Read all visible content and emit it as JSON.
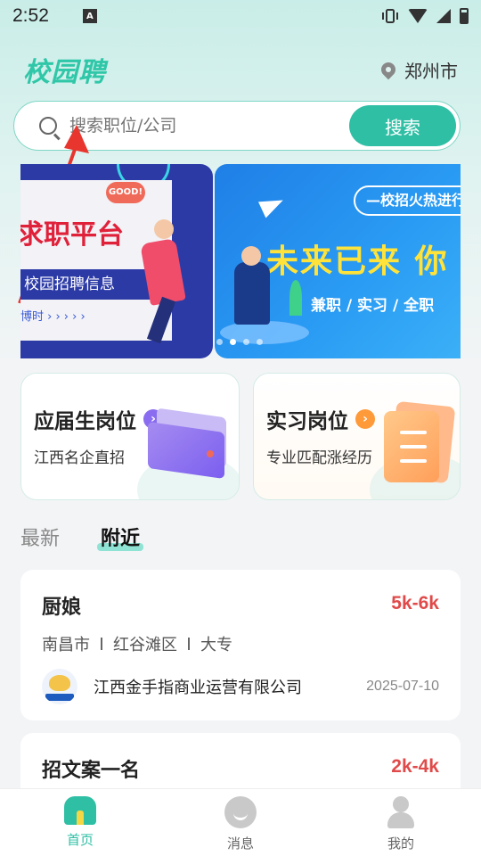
{
  "status_bar": {
    "time": "2:52",
    "app_badge": "A"
  },
  "header": {
    "logo": "校园聘",
    "city": "郑州市"
  },
  "search": {
    "placeholder": "搜索职位/公司",
    "button": "搜索"
  },
  "banner": {
    "left": {
      "title": "求职平台",
      "subtitle": "校园招聘信息",
      "time": "博时 › › › › ›",
      "badge": "GOOD!"
    },
    "right": {
      "tag": "—校招火热进行",
      "title": "未来已来 你",
      "subtitle": "兼职 / 实习 / 全职"
    },
    "page_count": 4,
    "active_page": 1
  },
  "categories": [
    {
      "title": "应届生岗位",
      "subtitle": "江西名企直招",
      "chevron": "›",
      "color": "#8a6cf0"
    },
    {
      "title": "实习岗位",
      "subtitle": "专业匹配涨经历",
      "chevron": "›",
      "color": "#ff9a3a"
    }
  ],
  "tabs": [
    {
      "label": "最新",
      "active": false
    },
    {
      "label": "附近",
      "active": true
    }
  ],
  "jobs": [
    {
      "title": "厨娘",
      "salary": "5k-6k",
      "city": "南昌市",
      "district": "红谷滩区",
      "education": "大专",
      "company": "江西金手指商业运营有限公司",
      "date": "2025-07-10"
    },
    {
      "title": "招文案一名",
      "salary": "2k-4k"
    }
  ],
  "bottom_nav": [
    {
      "label": "首页",
      "icon": "home-icon",
      "active": true
    },
    {
      "label": "消息",
      "icon": "message-icon",
      "active": false
    },
    {
      "label": "我的",
      "icon": "profile-icon",
      "active": false
    }
  ],
  "colors": {
    "accent": "#2fbfa5",
    "salary": "#e04a4a",
    "logo": "#2fc7a8"
  }
}
